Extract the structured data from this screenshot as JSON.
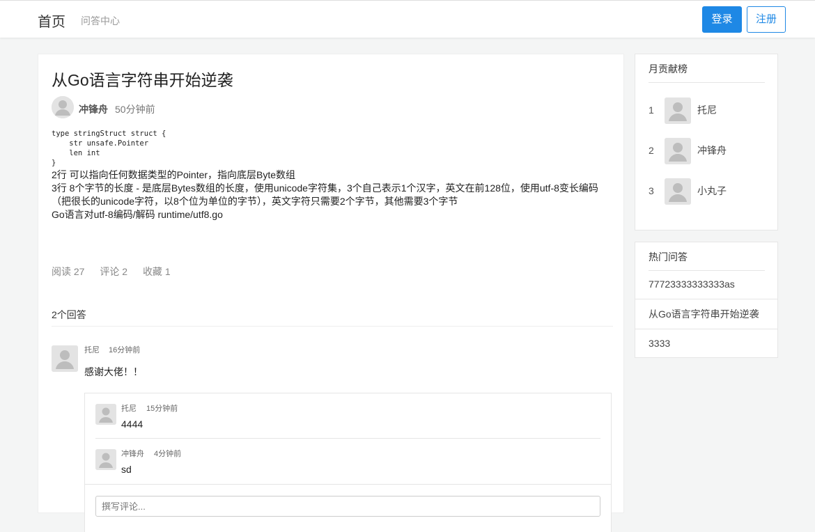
{
  "header": {
    "brand": "首页",
    "nav_qa": "问答中心",
    "login_label": "登录",
    "register_label": "注册"
  },
  "article": {
    "title": "从Go语言字符串开始逆袭",
    "author": "冲锋舟",
    "time": "50分钟前",
    "code": "type stringStruct struct {\n    str unsafe.Pointer\n    len int\n}",
    "lines": [
      "2行 可以指向任何数据类型的Pointer，指向底层Byte数组",
      "3行 8个字节的长度 - 是底层Bytes数组的长度，使用unicode字符集，3个自己表示1个汉字，英文在前128位，使用utf-8变长编码（把很长的unicode字符，以8个位为单位的字节），英文字符只需要2个字节，其他需要3个字节",
      "Go语言对utf-8编码/解码 runtime/utf8.go"
    ],
    "stats": {
      "reads": "阅读 27",
      "comments": "评论 2",
      "favorites": "收藏 1"
    }
  },
  "answers": {
    "title": "2个回答",
    "items": [
      {
        "name": "托尼",
        "time": "16分钟前",
        "content": "感谢大佬！！",
        "replies": [
          {
            "name": "托尼",
            "time": "15分钟前",
            "content": "4444"
          },
          {
            "name": "冲锋舟",
            "time": "4分钟前",
            "content": "sd"
          }
        ]
      }
    ],
    "comment_placeholder": "撰写评论..."
  },
  "ranking": {
    "title": "月贡献榜",
    "items": [
      {
        "rank": "1",
        "name": "托尼"
      },
      {
        "rank": "2",
        "name": "冲锋舟"
      },
      {
        "rank": "3",
        "name": "小丸子"
      }
    ]
  },
  "hot": {
    "title": "热门问答",
    "items": [
      "77723333333333as",
      "从Go语言字符串开始逆袭",
      "3333"
    ]
  },
  "colors": {
    "accent": "#1e88e5",
    "background": "#f4f5f5"
  }
}
